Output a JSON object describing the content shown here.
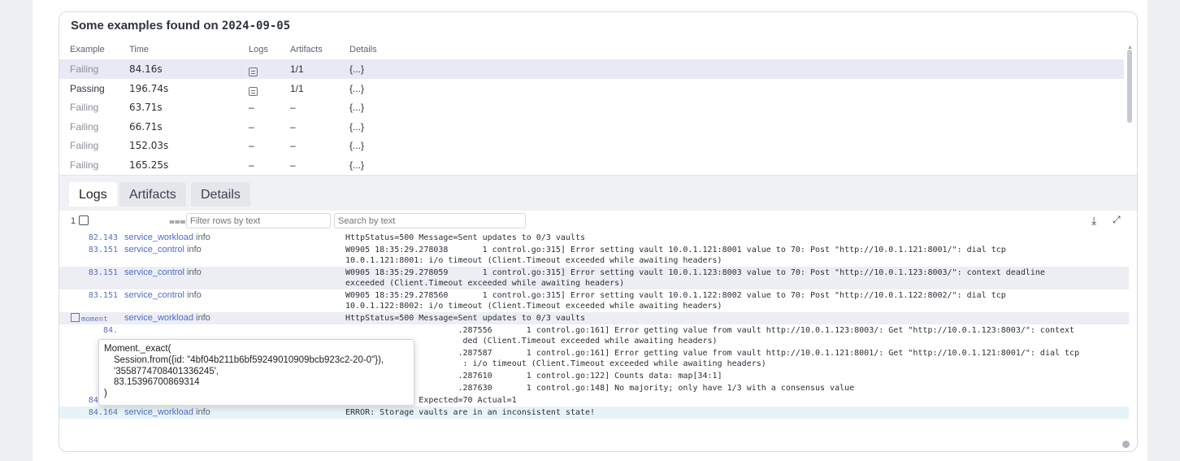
{
  "panel": {
    "title_prefix": "Some examples found on",
    "title_date": "2024-09-05"
  },
  "examples": {
    "headers": [
      "Example",
      "Time",
      "Logs",
      "Artifacts",
      "Details"
    ],
    "rows": [
      {
        "status": "Failing",
        "time": "84.16s",
        "logs": "icon",
        "artifacts": "1/1",
        "details": "{...}"
      },
      {
        "status": "Passing",
        "time": "196.74s",
        "logs": "icon",
        "artifacts": "1/1",
        "details": "{...}"
      },
      {
        "status": "Failing",
        "time": "63.71s",
        "logs": "–",
        "artifacts": "–",
        "details": "{...}"
      },
      {
        "status": "Failing",
        "time": "66.71s",
        "logs": "–",
        "artifacts": "–",
        "details": "{...}"
      },
      {
        "status": "Failing",
        "time": "152.03s",
        "logs": "–",
        "artifacts": "–",
        "details": "{...}"
      },
      {
        "status": "Failing",
        "time": "165.25s",
        "logs": "–",
        "artifacts": "–",
        "details": "{...}"
      }
    ]
  },
  "tabs": [
    "Logs",
    "Artifacts",
    "Details"
  ],
  "log_toolbar": {
    "count": "1",
    "filter_placeholder": "Filter rows by text",
    "search_placeholder": "Search by text"
  },
  "logs": [
    {
      "ts": "82.143",
      "svc": "service_workload",
      "lvl": "info",
      "msg": "HttpStatus=500 Message=Sent updates to 0/3 vaults",
      "style": ""
    },
    {
      "ts": "83.151",
      "svc": "service_control",
      "lvl": "info",
      "msg": "W0905 18:35:29.278038       1 control.go:315] Error setting vault 10.0.1.121:8001 value to 70: Post \"http://10.0.1.121:8001/\": dial tcp\n10.0.1.121:8001: i/o timeout (Client.Timeout exceeded while awaiting headers)",
      "style": ""
    },
    {
      "ts": "83.151",
      "svc": "service_control",
      "lvl": "info",
      "msg": "W0905 18:35:29.278059       1 control.go:315] Error setting vault 10.0.1.123:8003 value to 70: Post \"http://10.0.1.123:8003/\": context deadline\nexceeded (Client.Timeout exceeded while awaiting headers)",
      "style": "alt"
    },
    {
      "ts": "83.151",
      "svc": "service_control",
      "lvl": "info",
      "msg": "W0905 18:35:29.278560       1 control.go:315] Error setting vault 10.0.1.122:8002 value to 70: Post \"http://10.0.1.122:8002/\": dial tcp\n10.0.1.122:8002: i/o timeout (Client.Timeout exceeded while awaiting headers)",
      "style": ""
    },
    {
      "ts": "moment",
      "svc": "service_workload",
      "lvl": "info",
      "msg": "HttpStatus=500 Message=Sent updates to 0/3 vaults",
      "style": "alt"
    },
    {
      "ts": "84.",
      "svc": "",
      "lvl": "",
      "msg": "                       .287556       1 control.go:161] Error getting value from vault http://10.0.1.123:8003/: Get \"http://10.0.1.123:8003/\": context\n                        ded (Client.Timeout exceeded while awaiting headers)",
      "style": ""
    },
    {
      "ts": "84.",
      "svc": "",
      "lvl": "",
      "msg": "                       .287587       1 control.go:161] Error getting value from vault http://10.0.1.121:8001/: Get \"http://10.0.1.121:8001/\": dial tcp\n                        : i/o timeout (Client.Timeout exceeded while awaiting headers)",
      "style": ""
    },
    {
      "ts": "84.",
      "svc": "",
      "lvl": "",
      "msg": "                       .287610       1 control.go:122] Counts data: map[34:1]",
      "style": ""
    },
    {
      "ts": "84.",
      "svc": "",
      "lvl": "",
      "msg": "                       .287630       1 control.go:148] No majority; only have 1/3 with a consensus value",
      "style": ""
    },
    {
      "ts": "84.163",
      "svc": "service_workload",
      "lvl": "info",
      "msg": "HttpStatus=500 Expected=70 Actual=1",
      "style": ""
    },
    {
      "ts": "84.164",
      "svc": "service_workload",
      "lvl": "info",
      "msg": "ERROR: Storage vaults are in an inconsistent state!",
      "style": "hl"
    }
  ],
  "tooltip": {
    "line1": "Moment._exact(",
    "line2": "Session.from({id: \"4bf04b211b6bf59249010909bcb923c2-20-0\"}),",
    "line3": "'3558774708401336245',",
    "line4": "83.15396700869314",
    "line5": ")"
  },
  "colors": {
    "service": "#4f6bc9",
    "timestamp": "#5a6fb5",
    "selected_row": "#e8e9f5",
    "highlight_row": "#e6f4f8"
  }
}
